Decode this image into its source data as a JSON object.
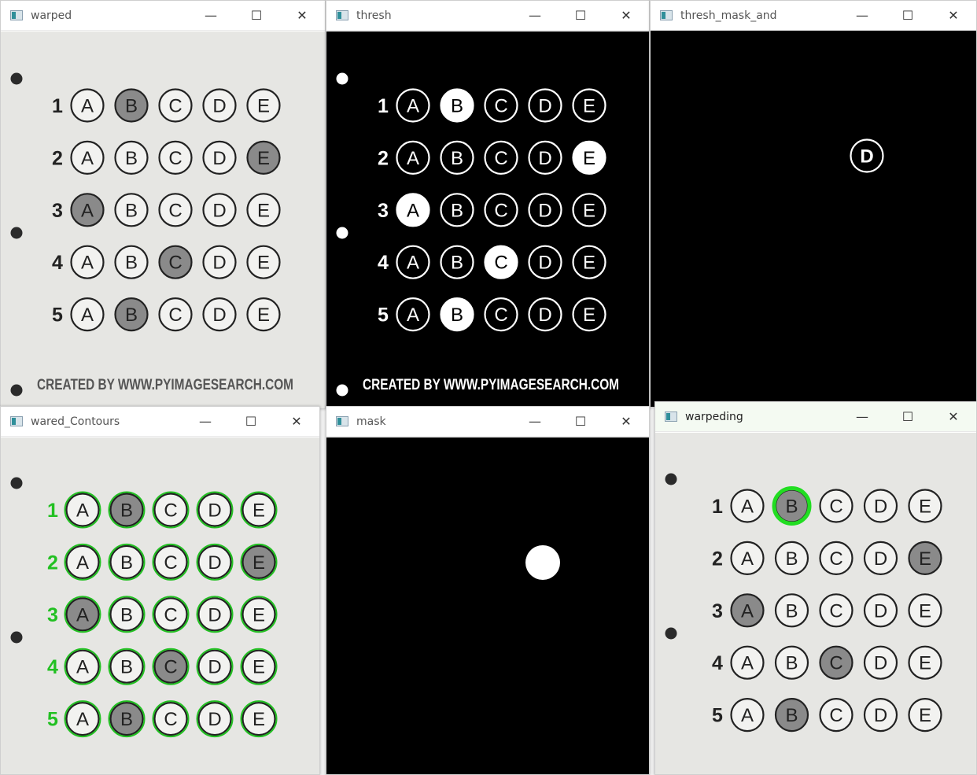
{
  "windows": {
    "warped": {
      "title": "warped"
    },
    "thresh": {
      "title": "thresh"
    },
    "thresh_mask_and": {
      "title": "thresh_mask_and"
    },
    "contours": {
      "title": "wared_Contours"
    },
    "mask": {
      "title": "mask"
    },
    "warpeding": {
      "title": "warpeding"
    }
  },
  "controls": {
    "minimize": "—",
    "maximize": "☐",
    "close": "✕"
  },
  "sheet": {
    "question_numbers": [
      "1",
      "2",
      "3",
      "4",
      "5"
    ],
    "choices": [
      "A",
      "B",
      "C",
      "D",
      "E"
    ],
    "filled_answers": [
      "B",
      "E",
      "A",
      "C",
      "B"
    ],
    "credit": "CREATED BY WWW.PYIMAGESEARCH.COM"
  },
  "thresh_mask_and": {
    "visible_choice": "D"
  },
  "colors": {
    "paper": "#e6e6e3",
    "bubble_outline": "#222222",
    "filled_bubble": "#8a8a8a",
    "contour_green": "#22c022",
    "highlight_green": "#22dd22",
    "threshold_white": "#ffffff",
    "threshold_black": "#000000"
  },
  "icons": [
    "app-icon",
    "minimize-icon",
    "maximize-icon",
    "close-icon"
  ]
}
